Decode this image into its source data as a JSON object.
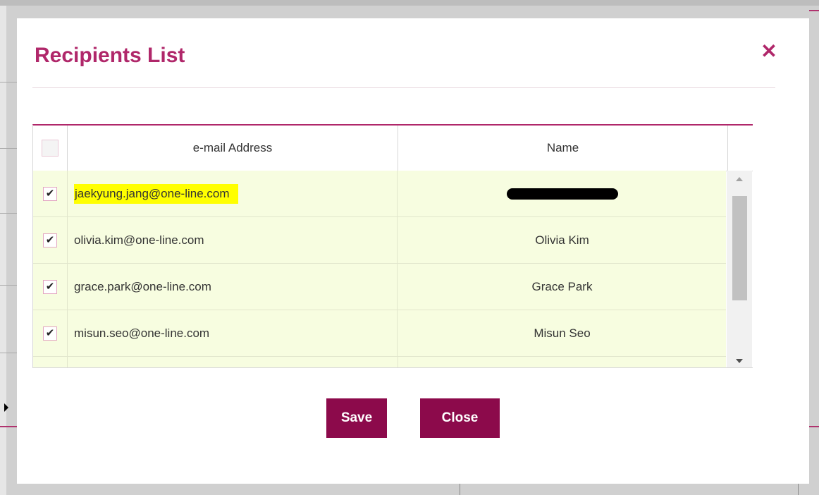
{
  "dialog": {
    "title": "Recipients List",
    "close_icon": "✕"
  },
  "table": {
    "columns": {
      "email": "e-mail Address",
      "name": "Name"
    },
    "rows": [
      {
        "email": "jaekyung.jang@one-line.com",
        "name": "",
        "checked": true,
        "email_highlighted": true,
        "name_redacted": true
      },
      {
        "email": "olivia.kim@one-line.com",
        "name": "Olivia Kim",
        "checked": true
      },
      {
        "email": "grace.park@one-line.com",
        "name": "Grace Park",
        "checked": true
      },
      {
        "email": "misun.seo@one-line.com",
        "name": "Misun Seo",
        "checked": true
      }
    ],
    "check_mark": "✔"
  },
  "buttons": {
    "save": "Save",
    "close": "Close"
  },
  "colors": {
    "accent": "#b0276a",
    "button": "#8c0a4b",
    "row_bg": "#f7fde0",
    "highlight": "#ffff00"
  }
}
